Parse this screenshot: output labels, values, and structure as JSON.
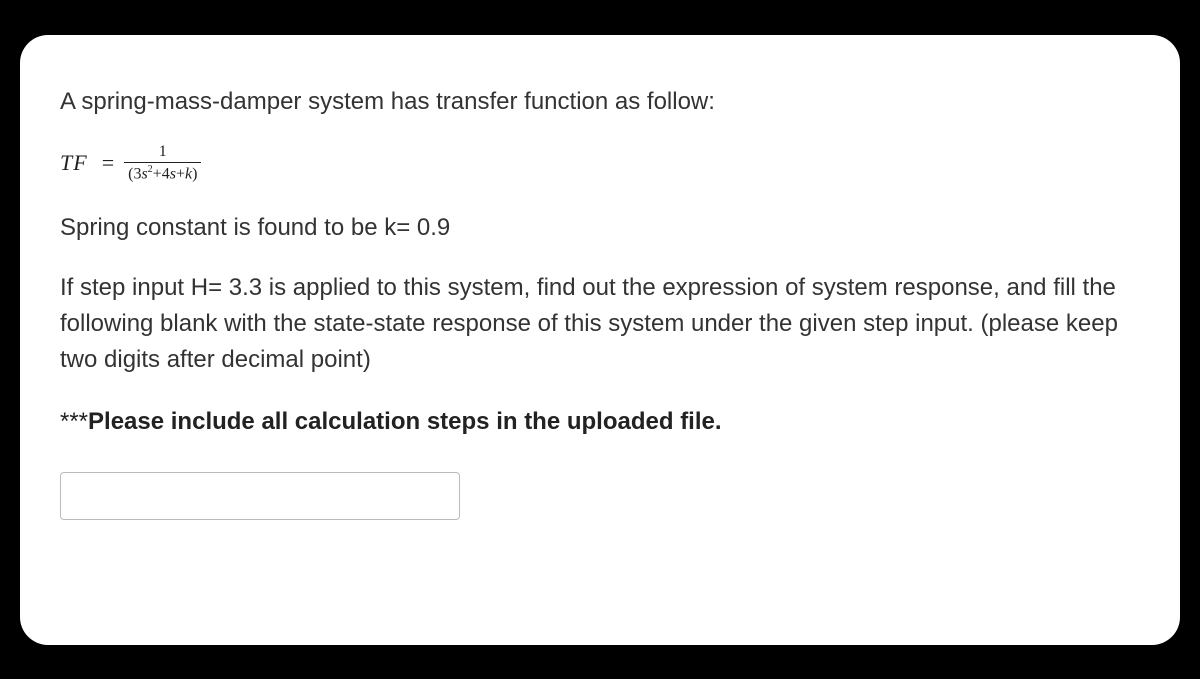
{
  "question": {
    "intro": "A spring-mass-damper system has transfer function as follow:",
    "equation": {
      "lhs": "TF",
      "eq": "=",
      "numerator": "1",
      "denominator_prefix": "(3",
      "denominator_s": "s",
      "denominator_sq": "2",
      "denominator_mid": "+4",
      "denominator_s2": "s",
      "denominator_suffix": "+",
      "denominator_k": "k",
      "denominator_close": ")"
    },
    "spring_constant_line": "Spring constant is found to be k= 0.9",
    "step_input_para": "If step input H= 3.3 is applied to this system, find out the expression of system response, and fill the following blank with the state-state response of this system under the given step input. (please keep two digits after decimal point)",
    "note_stars": "***",
    "note_text": "Please include all calculation steps in the uploaded file.",
    "answer_value": ""
  }
}
